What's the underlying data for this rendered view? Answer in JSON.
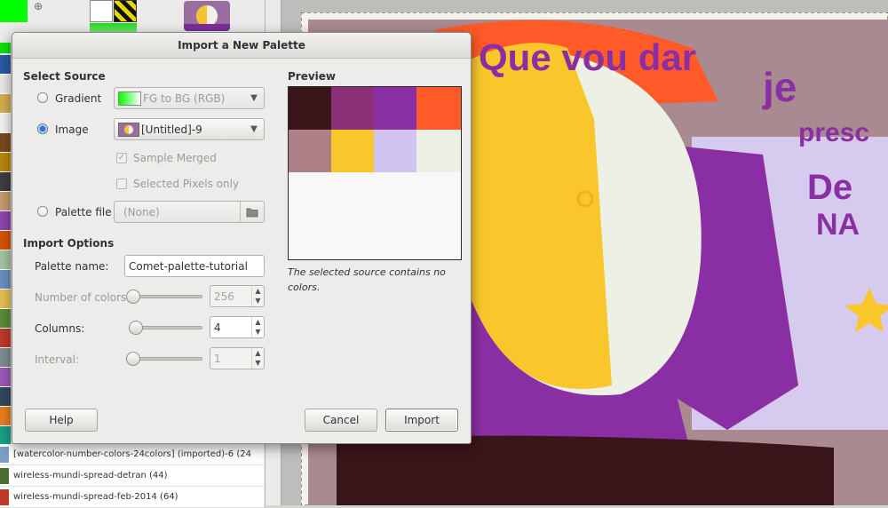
{
  "dialog": {
    "title": "Import a New Palette",
    "select_source_heading": "Select Source",
    "gradient_label": "Gradient",
    "gradient_value": "FG to BG (RGB)",
    "image_label": "Image",
    "image_value": "[Untitled]-9",
    "sample_merged_label": "Sample Merged",
    "selected_pixels_label": "Selected Pixels only",
    "palette_file_label": "Palette file",
    "palette_file_value": "(None)",
    "import_options_heading": "Import Options",
    "palette_name_label": "Palette name:",
    "palette_name_value": "Comet-palette-tutorial",
    "num_colors_label": "Number of colors:",
    "num_colors_value": "256",
    "columns_label": "Columns:",
    "columns_value": "4",
    "interval_label": "Interval:",
    "interval_value": "1",
    "preview_heading": "Preview",
    "preview_message": "The selected source contains no colors.",
    "preview_colors": [
      "#3a1519",
      "#8b2f78",
      "#8a2fa3",
      "#ff5a28",
      "#ad7f86",
      "#f9c72c",
      "#d0c4f0",
      "#edf1e5"
    ],
    "help_label": "Help",
    "cancel_label": "Cancel",
    "import_label": "Import"
  },
  "palette_list": [
    {
      "label": "[watercolor-number-colors-24colors] (imported)-6 (24",
      "swatch": "#7a9ec9"
    },
    {
      "label": "wireless-mundi-spread-detran (44)",
      "swatch": "#4b6f2e"
    },
    {
      "label": "wireless-mundi-spread-feb-2014 (64)",
      "swatch": "#c0392b"
    }
  ],
  "artwork_lettering": {
    "top_text": "Que vou dar",
    "je_text": "je",
    "presc_text": "presc",
    "de_text": "De",
    "na_text": "NA"
  }
}
